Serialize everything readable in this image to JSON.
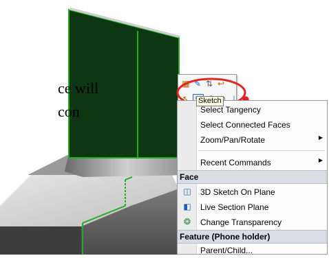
{
  "document": {
    "line1": "ce will",
    "line2": "con"
  },
  "toolbar": {
    "row1": [
      "select-other-icon",
      "sketch-icon",
      "normal-to-icon",
      "rollback-icon"
    ],
    "row2": [
      "selection-icon",
      "sketch-icon",
      "edit-sketch-icon",
      "section-icon",
      "view-icon",
      "appearance-icon"
    ],
    "tooltip": "Sketch"
  },
  "menu": {
    "items": [
      {
        "label": "Select Tangency",
        "underline": "",
        "submenu": false
      },
      {
        "label": "Select Connected Faces",
        "submenu": false
      },
      {
        "label": "Zoom/Pan/Rotate",
        "submenu": true
      },
      {
        "label": "Recent Commands",
        "submenu": true
      }
    ],
    "face_header": "Face",
    "face_items": [
      {
        "label": "3D Sketch On Plane",
        "icon": "3d-sketch-icon"
      },
      {
        "label": "Live Section Plane",
        "icon": "live-section-icon"
      },
      {
        "label": "Change Transparency",
        "icon": "transparency-icon"
      }
    ],
    "feature_header": "Feature (Phone holder)",
    "feature_items": [
      {
        "label": "Parent/Child..."
      }
    ]
  },
  "colors": {
    "highlight": "#1fae1f",
    "face": "#0c3712",
    "annotation": "#e0261f"
  }
}
